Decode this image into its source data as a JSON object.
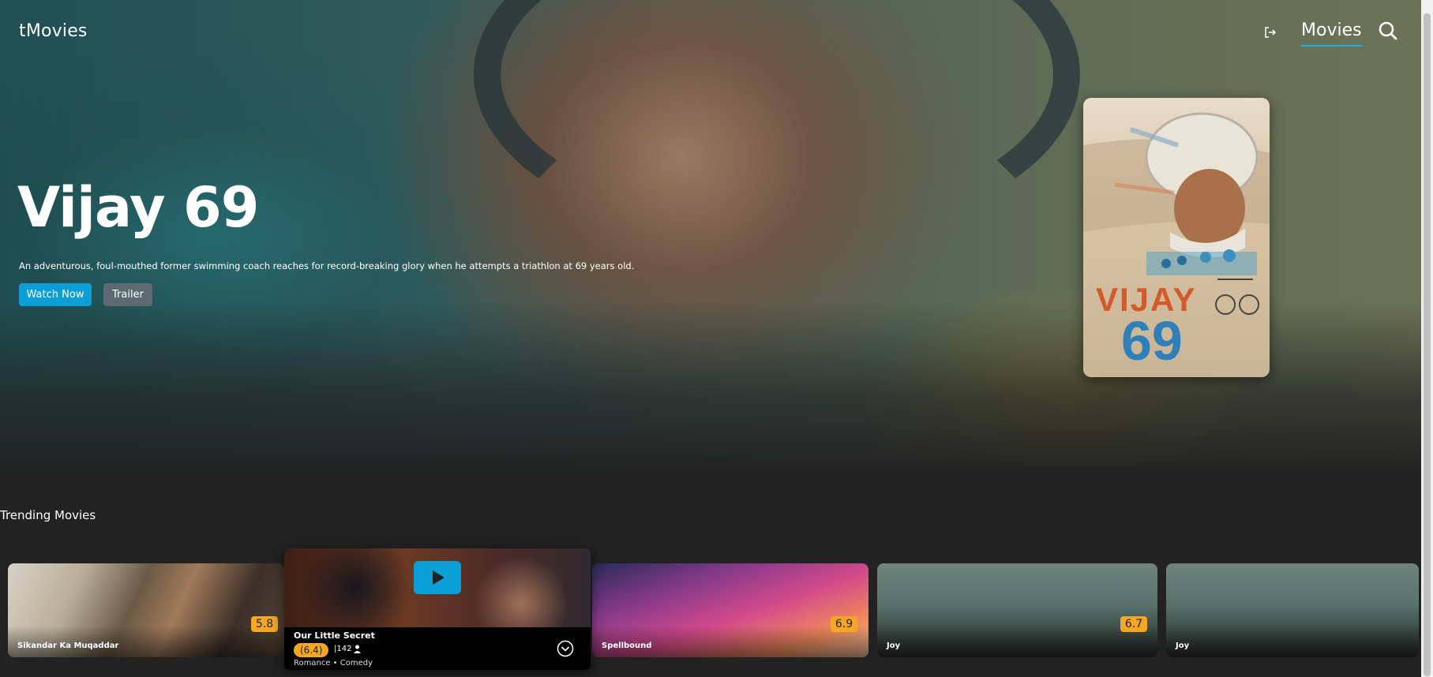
{
  "header": {
    "brand": "tMovies",
    "nav_movies": "Movies",
    "icons": [
      "logout-icon",
      "search-icon"
    ]
  },
  "hero": {
    "title": "Vijay 69",
    "description": "An adventurous, foul-mouthed former swimming coach reaches for record-breaking glory when he attempts a triathlon at 69 years old.",
    "watch_label": "Watch Now",
    "trailer_label": "Trailer",
    "poster": {
      "line1": "VIJAY",
      "line2": "69"
    }
  },
  "trending": {
    "title": "Trending Movies",
    "cards": [
      {
        "title": "Sikandar Ka Muqaddar",
        "rating": "5.8"
      },
      {
        "title": "Spellbound",
        "rating": "6.9"
      },
      {
        "title": "Joy",
        "rating": "6.7"
      },
      {
        "title": "Joy",
        "rating": ""
      }
    ],
    "hover_card": {
      "title": "Our Little Secret",
      "rating": "(6.4)",
      "votes": "|142",
      "genres": "Romance • Comedy"
    }
  },
  "colors": {
    "accent": "#0c9fd6",
    "rating": "#f5a623",
    "background": "#222222"
  }
}
